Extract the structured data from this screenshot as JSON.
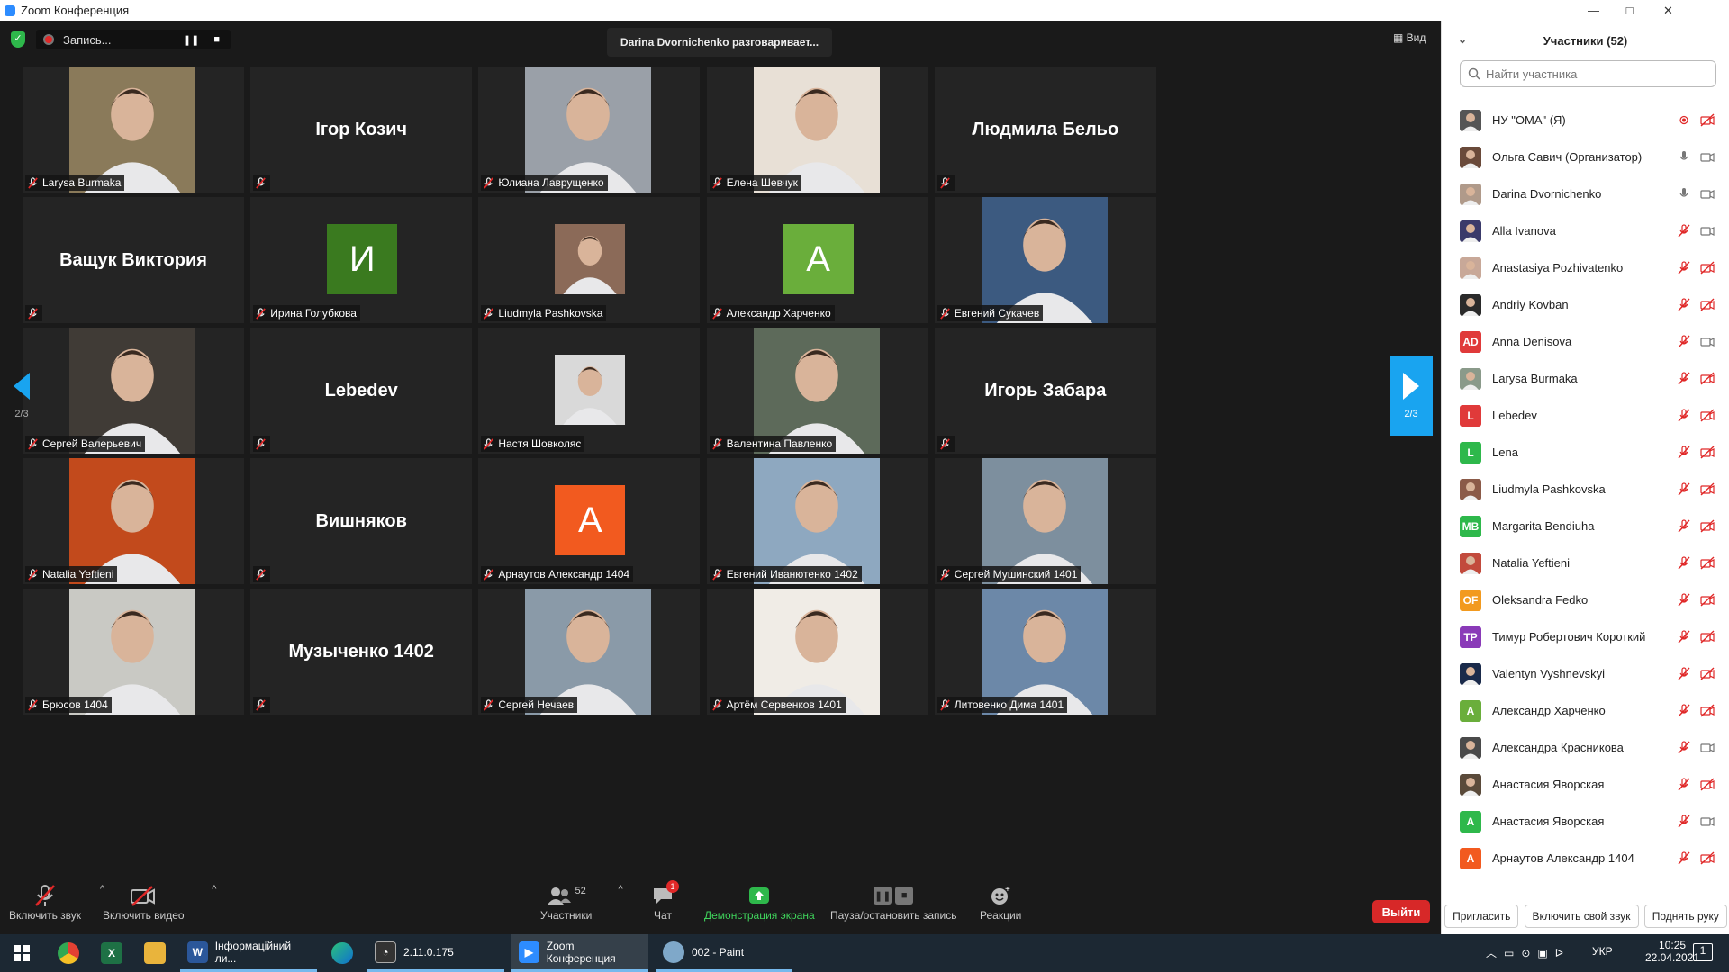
{
  "window": {
    "title": "Zoom Конференция",
    "minimize": "—",
    "maximize": "□",
    "close": "✕"
  },
  "topbar": {
    "recording_label": "Запись...",
    "pause": "❚❚",
    "stop": "■",
    "speaking": "Darina Dvornichenko разговаривает...",
    "view_label": "Вид"
  },
  "grid": {
    "tiles": [
      {
        "name": "Larysa Burmaka",
        "kind": "photo",
        "color": "#8a7a5a"
      },
      {
        "name": "",
        "kind": "name",
        "display": "Ігор Козич"
      },
      {
        "name": "Юлиана Лаврущенко",
        "kind": "photo",
        "color": "#9aa0a8"
      },
      {
        "name": "Елена Шевчук",
        "kind": "photo",
        "color": "#e8e0d6"
      },
      {
        "name": "",
        "kind": "name",
        "display": "Людмила Бельо"
      },
      {
        "name": "",
        "kind": "name",
        "display": "Ващук Виктория"
      },
      {
        "name": "Ирина Голубкова",
        "kind": "avatar",
        "letter": "И",
        "color": "#3a7a1f"
      },
      {
        "name": "Liudmyla Pashkovska",
        "kind": "small",
        "color": "#8b6a58"
      },
      {
        "name": "Александр Харченко",
        "kind": "avatar",
        "letter": "A",
        "color": "#6aae3b"
      },
      {
        "name": "Евгений Сукачев",
        "kind": "photo",
        "color": "#3c5a80"
      },
      {
        "name": "Сергей Валерьевич",
        "kind": "photo",
        "color": "#403b36"
      },
      {
        "name": "",
        "kind": "name",
        "display": "Lebedev"
      },
      {
        "name": "Настя Шовколяс",
        "kind": "small",
        "color": "#d9d9d9"
      },
      {
        "name": "Валентина Павленко",
        "kind": "photo",
        "color": "#5d6a5a"
      },
      {
        "name": "",
        "kind": "name",
        "display": "Игорь Забара"
      },
      {
        "name": "Natalia Yeftieni",
        "kind": "photo",
        "color": "#c24a1c"
      },
      {
        "name": "",
        "kind": "name",
        "display": "Вишняков"
      },
      {
        "name": "Арнаутов Александр 1404",
        "kind": "avatar",
        "letter": "A",
        "color": "#f25a1f"
      },
      {
        "name": "Евгений Иванютенко 1402",
        "kind": "photo",
        "color": "#8ea8c0"
      },
      {
        "name": "Сергей Мушинский 1401",
        "kind": "photo",
        "color": "#7d8f9e"
      },
      {
        "name": "Брюсов 1404",
        "kind": "photo",
        "color": "#c9c9c4"
      },
      {
        "name": "",
        "kind": "name",
        "display": "Музыченко 1402"
      },
      {
        "name": "Сергей Нечаев",
        "kind": "photo",
        "color": "#8a9aa8"
      },
      {
        "name": "Артём Сервенков 1401",
        "kind": "photo",
        "color": "#f0ece6"
      },
      {
        "name": "Литовенко Дима 1401",
        "kind": "photo",
        "color": "#6c88a8"
      }
    ],
    "page_left": "2/3",
    "page_right": "2/3"
  },
  "toolbar": {
    "mute": "Включить звук",
    "video": "Включить видео",
    "participants": "Участники",
    "participants_count": "52",
    "chat": "Чат",
    "chat_badge": "1",
    "share": "Демонстрация экрана",
    "record": "Пауза/остановить запись",
    "reactions": "Реакции",
    "leave": "Выйти",
    "caret": "^"
  },
  "panel": {
    "title": "Участники (52)",
    "chevron": "⌄",
    "search_placeholder": "Найти участника",
    "participants": [
      {
        "name": "НУ \"ОМА\" (Я)",
        "avatar": "photo",
        "color": "#555",
        "mic": "rec-off",
        "cam": "off"
      },
      {
        "name": "Ольга Савич (Организатор)",
        "avatar": "photo",
        "color": "#6a4a3a",
        "mic": "on",
        "cam": "on"
      },
      {
        "name": "Darina Dvornichenko",
        "avatar": "photo",
        "color": "#b09a8a",
        "mic": "on",
        "cam": "on"
      },
      {
        "name": "Alla Ivanova",
        "avatar": "photo",
        "color": "#3a3a6a",
        "mic": "off",
        "cam": "on"
      },
      {
        "name": "Anastasiya Pozhivatenko",
        "avatar": "photo",
        "color": "#c8a898",
        "mic": "off",
        "cam": "off"
      },
      {
        "name": "Andriy Kovban",
        "avatar": "photo",
        "color": "#2a2a2a",
        "mic": "off",
        "cam": "off"
      },
      {
        "name": "Anna Denisova",
        "avatar": "AD",
        "color": "#e03a3a",
        "mic": "off",
        "cam": "on"
      },
      {
        "name": "Larysa Burmaka",
        "avatar": "photo",
        "color": "#8a9a8a",
        "mic": "off",
        "cam": "off"
      },
      {
        "name": "Lebedev",
        "avatar": "L",
        "color": "#e03a3a",
        "mic": "off",
        "cam": "off"
      },
      {
        "name": "Lena",
        "avatar": "L",
        "color": "#2eb84b",
        "mic": "off",
        "cam": "off"
      },
      {
        "name": "Liudmyla Pashkovska",
        "avatar": "photo",
        "color": "#8b5a48",
        "mic": "off",
        "cam": "off"
      },
      {
        "name": "Margarita Bendiuha",
        "avatar": "MB",
        "color": "#2eb84b",
        "mic": "off",
        "cam": "off"
      },
      {
        "name": "Natalia Yeftieni",
        "avatar": "photo",
        "color": "#c24a3c",
        "mic": "off",
        "cam": "off"
      },
      {
        "name": "Oleksandra Fedko",
        "avatar": "OF",
        "color": "#f29a1f",
        "mic": "off",
        "cam": "off"
      },
      {
        "name": "Тимур Робертович Короткий",
        "avatar": "TP",
        "color": "#8a3ab8",
        "mic": "off",
        "cam": "off"
      },
      {
        "name": "Valentyn Vyshnevskyi",
        "avatar": "photo",
        "color": "#1a2a4a",
        "mic": "off",
        "cam": "off"
      },
      {
        "name": "Александр Харченко",
        "avatar": "A",
        "color": "#6aae3b",
        "mic": "off",
        "cam": "off"
      },
      {
        "name": "Александра Красникова",
        "avatar": "photo",
        "color": "#4a4a4a",
        "mic": "off",
        "cam": "on"
      },
      {
        "name": "Анастасия Яворская",
        "avatar": "photo",
        "color": "#5a4a3a",
        "mic": "off",
        "cam": "off"
      },
      {
        "name": "Анастасия Яворская",
        "avatar": "A",
        "color": "#2eb84b",
        "mic": "off",
        "cam": "on"
      },
      {
        "name": "Арнаутов Александр 1404",
        "avatar": "A",
        "color": "#f25a1f",
        "mic": "off",
        "cam": "off"
      }
    ],
    "invite": "Пригласить",
    "unmute_me": "Включить свой звук",
    "raise_hand": "Поднять руку"
  },
  "taskbar": {
    "items": [
      {
        "label": "",
        "kind": "start"
      },
      {
        "label": "",
        "kind": "chrome"
      },
      {
        "label": "",
        "kind": "excel"
      },
      {
        "label": "",
        "kind": "explorer"
      },
      {
        "label": "Інформаційний ли...",
        "kind": "word"
      },
      {
        "label": "",
        "kind": "edge"
      },
      {
        "label": "2.11.0.175",
        "kind": "app"
      },
      {
        "label": "Zoom Конференция",
        "kind": "zoom"
      },
      {
        "label": "002 - Paint",
        "kind": "paint"
      }
    ],
    "lang": "УКР",
    "time": "10:25",
    "date": "22.04.2021",
    "notif_badge": "1"
  }
}
